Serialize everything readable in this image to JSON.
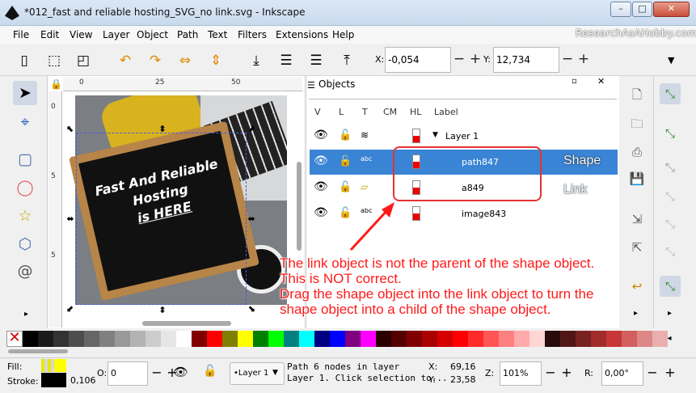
{
  "window": {
    "title": "*012_fast and reliable hosting_SVG_no link.svg - Inkscape",
    "minimize": "–",
    "maximize": "□",
    "close": "✕"
  },
  "watermark": "ResearchAsAHobby.com",
  "menu": [
    "File",
    "Edit",
    "View",
    "Layer",
    "Object",
    "Path",
    "Text",
    "Filters",
    "Extensions",
    "Help"
  ],
  "toolbar": {
    "x_label": "X:",
    "x_value": "-0,054",
    "y_label": "Y:",
    "y_value": "12,734",
    "minus": "−",
    "plus": "+",
    "more": "▼"
  },
  "ruler": {
    "h_ticks": [
      "0",
      "25",
      "50"
    ],
    "v_ticks": [
      "0",
      "5",
      "5"
    ]
  },
  "canvas": {
    "board_lines": [
      "Fast And Reliable",
      "Hosting",
      "is HERE"
    ]
  },
  "panel": {
    "title": "Objects",
    "columns": [
      "V",
      "L",
      "T",
      "CM",
      "HL",
      "Label"
    ],
    "rows": [
      {
        "label": "Layer 1",
        "type": "layer",
        "selected": false
      },
      {
        "label": "path847",
        "type": "path",
        "selected": true
      },
      {
        "label": "a849",
        "type": "link",
        "selected": false
      },
      {
        "label": "image843",
        "type": "image",
        "selected": false
      }
    ]
  },
  "annotation": {
    "shape_label": "Shape",
    "link_label": "Link",
    "lines": [
      "The link object is not the parent of the shape object.",
      "This is NOT correct.",
      "Drag the shape object into the link object to turn the",
      "shape object into a child of the shape object."
    ]
  },
  "status": {
    "fill_label": "Fill:",
    "stroke_label": "Stroke:",
    "stroke_width": "0,106",
    "o_label": "O:",
    "o_value": "0",
    "layer_select": "•Layer 1",
    "message_line1": "Path 6 nodes in layer",
    "message_line2": "Layer 1. Click selection to...",
    "x_label": "X:",
    "x_value": "69,16",
    "y_label": "Y:",
    "y_value": "23,58",
    "z_label": "Z:",
    "zoom": "101%",
    "r_label": "R:",
    "rotation": "0,00°"
  },
  "colors": {
    "selected_row": "#3a84d6",
    "annotation": "#ff1a1a",
    "selection_box": "#4a5be0"
  },
  "palette": [
    "#000000",
    "#1a1a1a",
    "#333333",
    "#4d4d4d",
    "#666666",
    "#808080",
    "#999999",
    "#b3b3b3",
    "#cccccc",
    "#e6e6e6",
    "#ffffff",
    "#800000",
    "#ff0000",
    "#808000",
    "#ffff00",
    "#008000",
    "#00ff00",
    "#008080",
    "#00ffff",
    "#000080",
    "#0000ff",
    "#800080",
    "#ff00ff",
    "#2b0000",
    "#550000",
    "#800000",
    "#aa0000",
    "#d40000",
    "#ff0000",
    "#ff2a2a",
    "#ff5555",
    "#ff8080",
    "#ffaaaa",
    "#ffd5d5",
    "#280b0b",
    "#501616",
    "#782121",
    "#a02c2c",
    "#c83737",
    "#d35f5f",
    "#de8787",
    "#e9afaf"
  ]
}
